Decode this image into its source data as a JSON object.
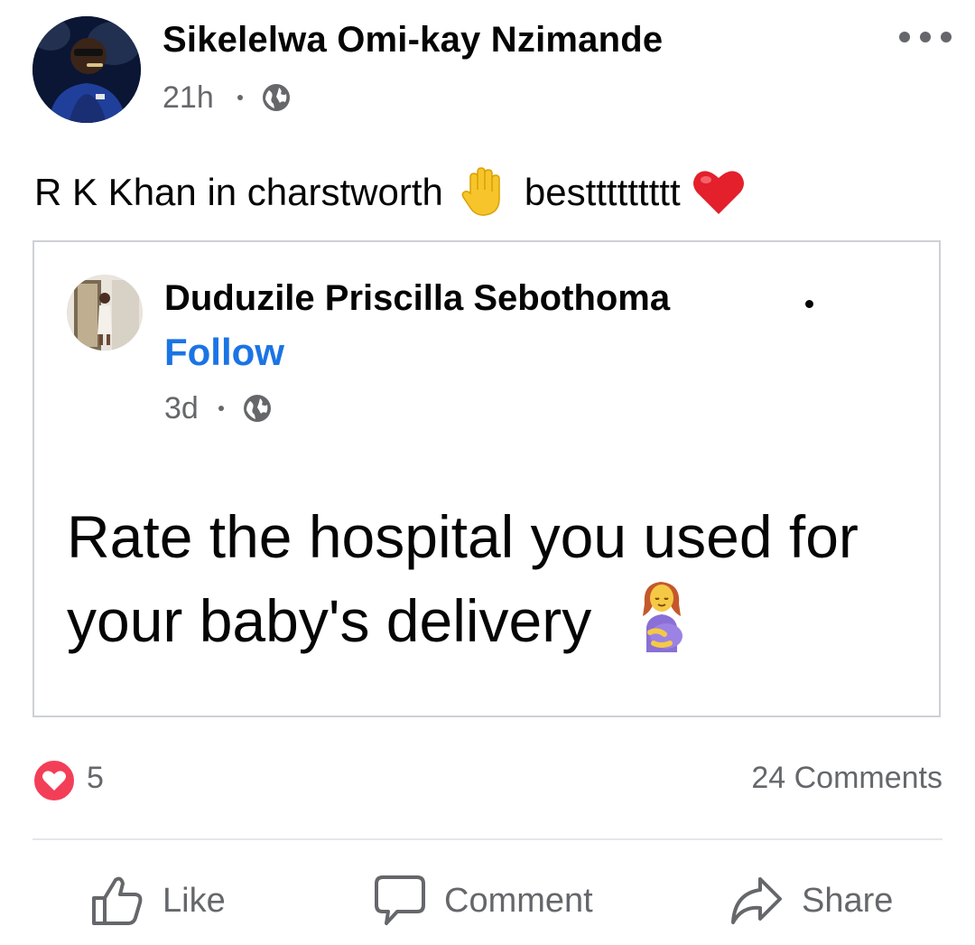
{
  "post": {
    "author_name": "Sikelelwa Omi-kay Nzimande",
    "time": "21h",
    "text": "R K Khan in charstworth",
    "text_suffix": "besttttttttt"
  },
  "shared_post": {
    "author_name": "Duduzile Priscilla Sebothoma",
    "follow_label": "Follow",
    "time": "3d",
    "text": "Rate the hospital you used for your baby's delivery"
  },
  "stats": {
    "reaction_count": "5",
    "comments_label": "24 Comments"
  },
  "actions": {
    "like_label": "Like",
    "comment_label": "Comment",
    "share_label": "Share"
  },
  "icons": {
    "privacy": "globe-icon",
    "more": "more-options-icon",
    "reaction": "love-reaction-icon",
    "like": "thumbs-up-icon",
    "comment": "speech-bubble-icon",
    "share": "share-arrow-icon"
  },
  "colors": {
    "follow": "#1b74e4",
    "love_reaction": "#f33e58",
    "secondary_text": "#65676b"
  }
}
